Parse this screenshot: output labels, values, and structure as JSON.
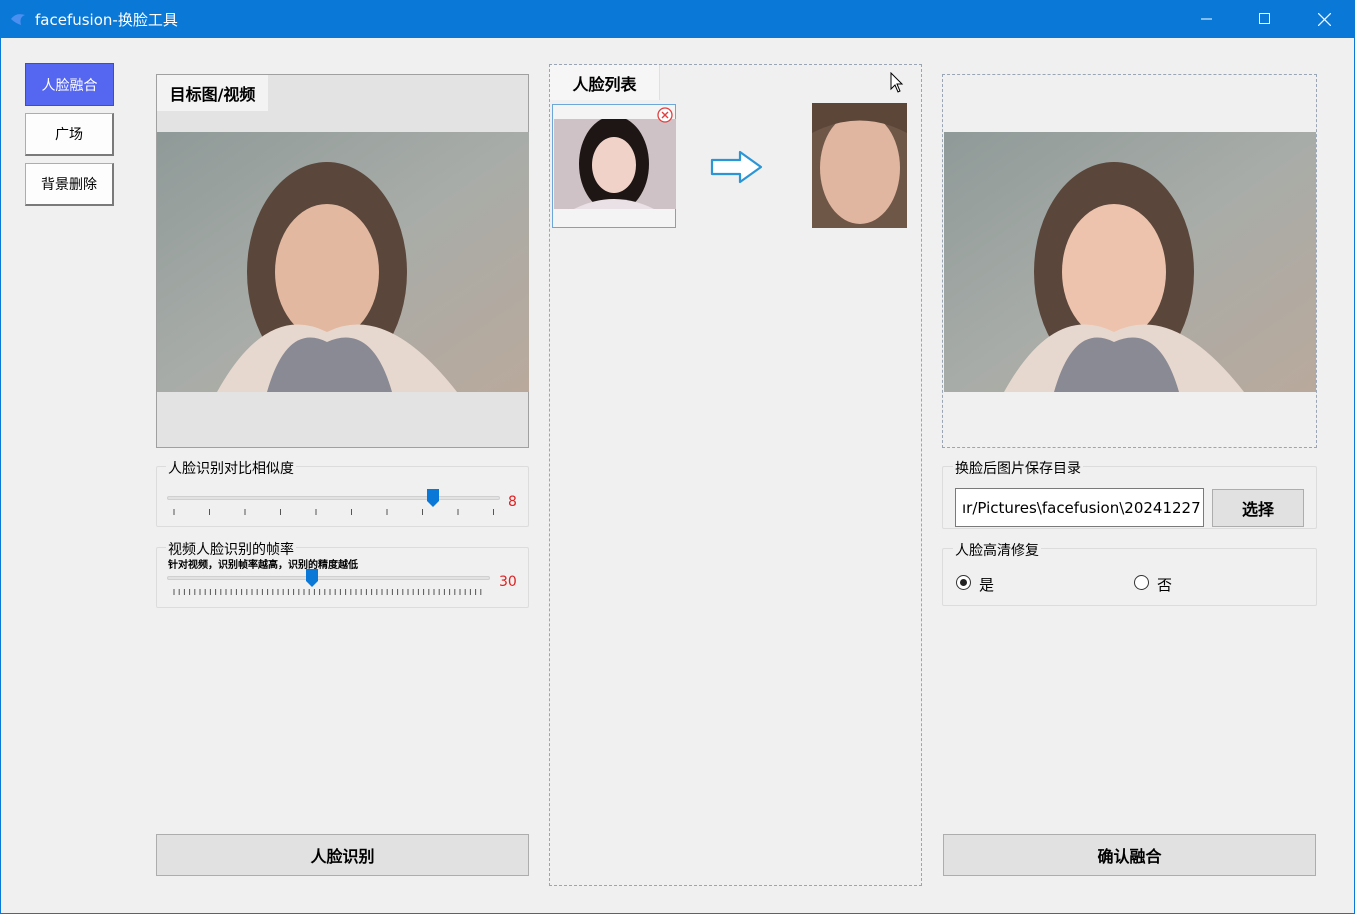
{
  "window": {
    "title": "facefusion-换脸工具",
    "minimize": "—",
    "maximize": "☐",
    "close": "✕"
  },
  "nav": {
    "items": [
      "人脸融合",
      "广场",
      "背景删除"
    ]
  },
  "target_panel": {
    "tab": "目标图/视频"
  },
  "similarity": {
    "title": "人脸识别对比相似度",
    "value": "8",
    "fraction": 0.8
  },
  "frame_rate": {
    "title": "视频人脸识别的帧率",
    "hint": "针对视频，识别帧率越高，识别的精度越低",
    "value": "30",
    "fraction": 0.45
  },
  "face_list": {
    "tab": "人脸列表"
  },
  "save_dir": {
    "title": "换脸后图片保存目录",
    "path": "ır/Pictures\\facefusion\\20241227",
    "select_label": "选择"
  },
  "enhance": {
    "title": "人脸高清修复",
    "yes": "是",
    "no": "否",
    "selected": "是"
  },
  "buttons": {
    "detect": "人脸识别",
    "confirm": "确认融合"
  },
  "colors": {
    "titlebar": "#0a78d7",
    "nav_active": "#5566f0",
    "slider_value": "#e02020",
    "slider_thumb": "#0a78d7"
  }
}
